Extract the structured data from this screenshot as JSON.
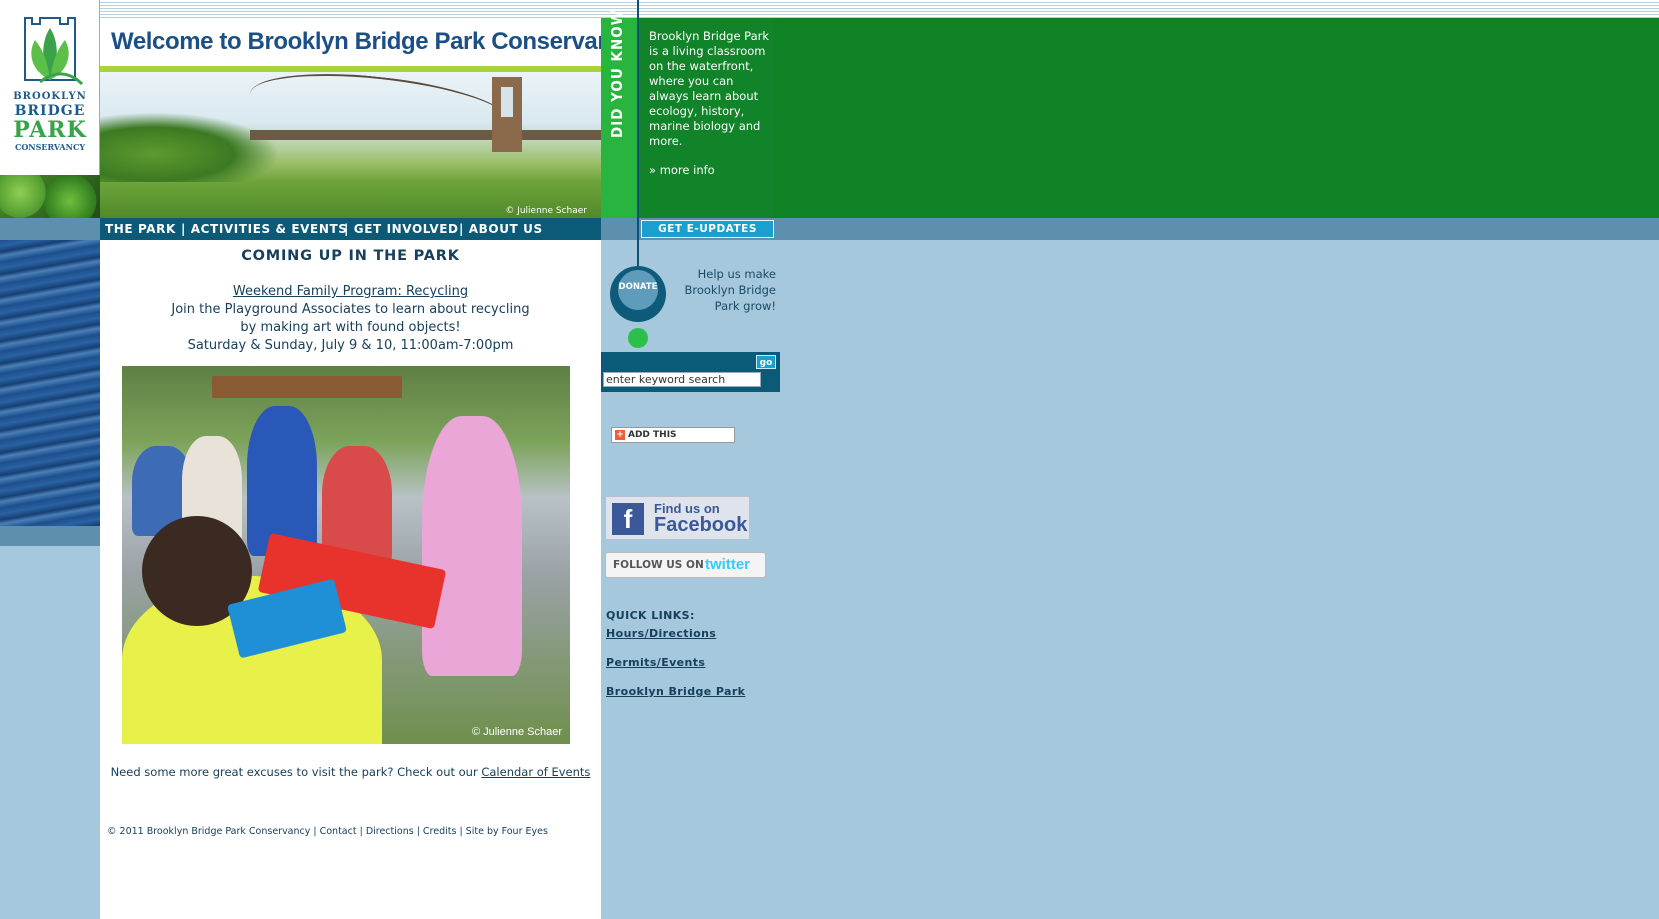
{
  "header": {
    "site_title": "Welcome to Brooklyn Bridge Park Conservancy",
    "hero_credit": "© Julienne Schaer",
    "logo": {
      "line1": "BROOKLYN",
      "line2": "BRIDGE",
      "line3": "PARK",
      "line4": "CONSERVANCY"
    }
  },
  "did_you_know": {
    "label": "DID YOU KNOW",
    "text": "Brooklyn Bridge Park is a living classroom on the waterfront, where you can always learn about ecology, history, marine biology and more.",
    "more": "» more info"
  },
  "nav": {
    "items": [
      "THE PARK",
      "| ACTIVITIES & EVENTS",
      "| GET INVOLVED",
      "| ABOUT US"
    ],
    "eupdates": "GET  E-UPDATES"
  },
  "main": {
    "heading": "COMING UP IN THE PARK",
    "event_title": "Weekend Family Program: Recycling",
    "event_desc_1": "Join the Playground Associates to learn about recycling",
    "event_desc_2": "by making art with found objects!",
    "event_when": "Saturday & Sunday, July 9 & 10, 11:00am-7:00pm",
    "photo_credit": "© Julienne Schaer",
    "excuses_text": "Need some more great excuses to visit the park? Check out our ",
    "excuses_link": "Calendar of Events",
    "footer": "© 2011 Brooklyn Bridge Park Conservancy | Contact | Directions | Credits | Site by Four Eyes"
  },
  "sidebar": {
    "donate": "DONATE",
    "help_text": "Help us make Brooklyn Bridge Park grow!",
    "search_go": "go",
    "search_value": "enter keyword search",
    "addthis": "ADD THIS",
    "facebook_line1": "Find us on",
    "facebook_line2": "Facebook",
    "twitter_follow": "FOLLOW US ON",
    "twitter_brand": "twitter",
    "quick_links_title": "QUICK LINKS:",
    "quick_links": [
      "Hours/Directions",
      "Permits/Events",
      "Brooklyn Bridge Park"
    ]
  },
  "colors": {
    "nav_blue": "#0b5a78",
    "green": "#0f8226",
    "bright_green": "#27b43f",
    "page_bg": "#a6c8dc"
  }
}
